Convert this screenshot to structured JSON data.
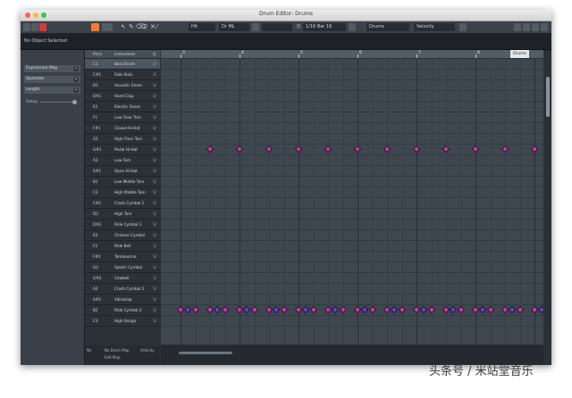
{
  "window": {
    "title": "Drum Editor: Drums"
  },
  "traffic_lights": {
    "close": "#fc605c",
    "minimize": "#fdbc40",
    "zoom": "#34c84a"
  },
  "toolbar": {
    "field1": "Hit",
    "field2": "Dr ML",
    "quantize": "1/16 Bar 16",
    "quantize_prefix": "Q",
    "map_field": "Drums",
    "velocity_field": "Velocity",
    "accent": "#ef7d32",
    "record": "#d63b35"
  },
  "info": {
    "status": "No Object Selected"
  },
  "inspector": {
    "sections": [
      "Expression Map",
      "Quantize",
      "Length"
    ],
    "setup_label": "Setup"
  },
  "drum_list": {
    "headers": {
      "pitch": "Pitch",
      "instrument": "Instrument",
      "quantize": "Q"
    },
    "quantize_value": "1/",
    "rows": [
      {
        "pitch": "C1",
        "instrument": "Bass Drum"
      },
      {
        "pitch": "C#1",
        "instrument": "Side Stick"
      },
      {
        "pitch": "D1",
        "instrument": "Acoustic Snare"
      },
      {
        "pitch": "D#1",
        "instrument": "Hand Clap"
      },
      {
        "pitch": "E1",
        "instrument": "Electric Snare"
      },
      {
        "pitch": "F1",
        "instrument": "Low Floor Tom"
      },
      {
        "pitch": "F#1",
        "instrument": "Closed Hi-Hat"
      },
      {
        "pitch": "G1",
        "instrument": "High Floor Tom"
      },
      {
        "pitch": "G#1",
        "instrument": "Pedal Hi-Hat"
      },
      {
        "pitch": "A1",
        "instrument": "Low Tom"
      },
      {
        "pitch": "A#1",
        "instrument": "Open Hi-Hat"
      },
      {
        "pitch": "B1",
        "instrument": "Low Middle Tom"
      },
      {
        "pitch": "C2",
        "instrument": "High Middle Tom"
      },
      {
        "pitch": "C#2",
        "instrument": "Crash Cymbal 1"
      },
      {
        "pitch": "D2",
        "instrument": "High Tom"
      },
      {
        "pitch": "D#2",
        "instrument": "Ride Cymbal 1"
      },
      {
        "pitch": "E2",
        "instrument": "Chinese Cymbal"
      },
      {
        "pitch": "F2",
        "instrument": "Ride Bell"
      },
      {
        "pitch": "F#2",
        "instrument": "Tambourine"
      },
      {
        "pitch": "G2",
        "instrument": "Splash Cymbal"
      },
      {
        "pitch": "G#2",
        "instrument": "Cowbell"
      },
      {
        "pitch": "A2",
        "instrument": "Crash Cymbal 2"
      },
      {
        "pitch": "A#2",
        "instrument": "Vibraslap"
      },
      {
        "pitch": "B2",
        "instrument": "Ride Cymbal 2"
      },
      {
        "pitch": "C3",
        "instrument": "High Bongo"
      }
    ],
    "footer": {
      "left": "No",
      "map": "No Drum Map",
      "vel": "Velocity",
      "sub": "Edit Map"
    }
  },
  "grid": {
    "ruler_labels": [
      "3",
      "4",
      "5",
      "6",
      "7",
      "8"
    ],
    "track_key": "Drums",
    "hihat_row": 8,
    "hihat_hits": [
      0.5,
      1.0,
      1.5,
      2.0,
      2.5,
      3.0,
      3.5,
      4.0,
      4.5,
      5.0,
      5.5,
      6.0
    ],
    "ride_row": 23,
    "ride_hits": [
      0.0,
      0.125,
      0.25,
      0.5,
      0.625,
      0.75,
      1.0,
      1.125,
      1.25,
      1.5,
      1.625,
      1.75,
      2.0,
      2.125,
      2.25,
      2.5,
      2.625,
      2.75,
      3.0,
      3.125,
      3.25,
      3.5,
      3.625,
      3.75,
      4.0,
      4.125,
      4.25,
      4.5,
      4.625,
      4.75,
      5.0,
      5.125,
      5.25,
      5.5,
      5.625,
      5.75,
      6.0,
      6.125
    ],
    "note_color_pink": "#b8439d",
    "note_color_blue": "#5a49c9"
  },
  "watermark": "头条号 / 米站堂音乐"
}
